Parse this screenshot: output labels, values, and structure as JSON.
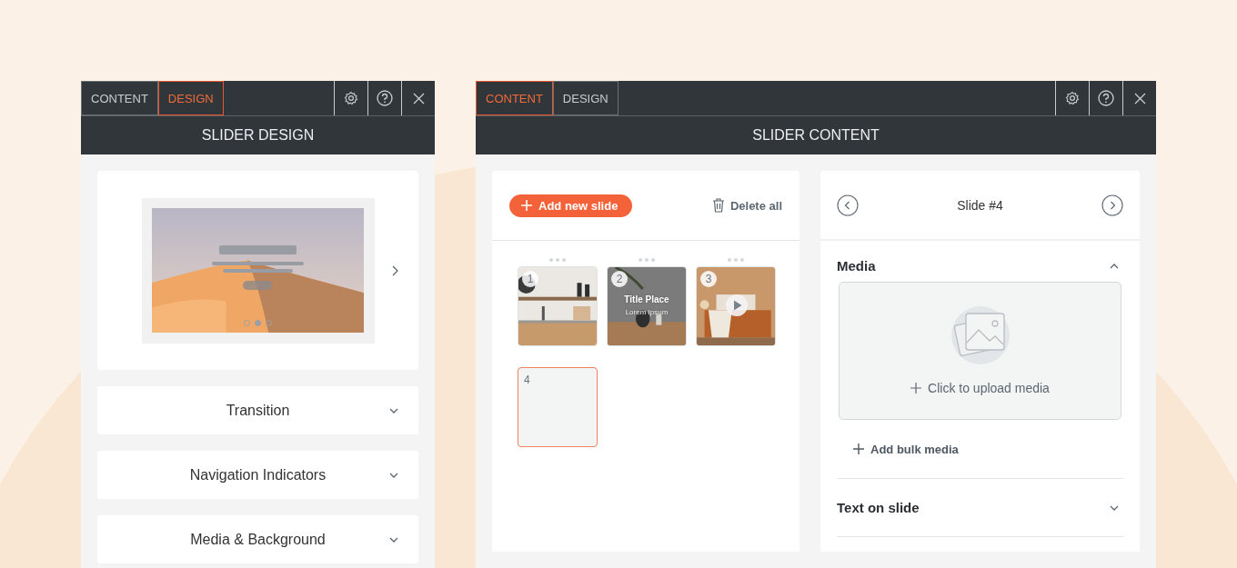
{
  "design_panel": {
    "tabs": [
      {
        "label": "CONTENT",
        "selected": false
      },
      {
        "label": "DESIGN",
        "selected": true
      }
    ],
    "title": "SLIDER DESIGN",
    "preview": {
      "kind": "picture",
      "dots": [
        {
          "selected": false
        },
        {
          "selected": true
        },
        {
          "selected": false
        }
      ]
    },
    "sections": [
      {
        "label": "Transition",
        "expanded": false
      },
      {
        "label": "Navigation Indicators",
        "expanded": false
      },
      {
        "label": "Media & Background",
        "expanded": false
      }
    ]
  },
  "content_panel": {
    "tabs": [
      {
        "label": "CONTENT",
        "selected": true
      },
      {
        "label": "DESIGN",
        "selected": false
      }
    ],
    "title": "SLIDER CONTENT",
    "add_button": "Add new slide",
    "delete_button": "Delete all",
    "slides": [
      {
        "number": "1",
        "kind": "kitchen",
        "selected": false
      },
      {
        "number": "2",
        "kind": "vase",
        "selected": false,
        "title": "Title Place",
        "subtitle": "Lorem Ipsum"
      },
      {
        "number": "3",
        "kind": "bedroom",
        "selected": false,
        "video": true
      },
      {
        "number": "4",
        "kind": "empty",
        "selected": true
      }
    ],
    "detail": {
      "title": "Slide #4",
      "media": {
        "label": "Media",
        "expanded": true,
        "upload": "Click to upload media",
        "bulk": "Add bulk media"
      },
      "sections": [
        {
          "label": "Text on slide",
          "expanded": false
        }
      ]
    }
  }
}
